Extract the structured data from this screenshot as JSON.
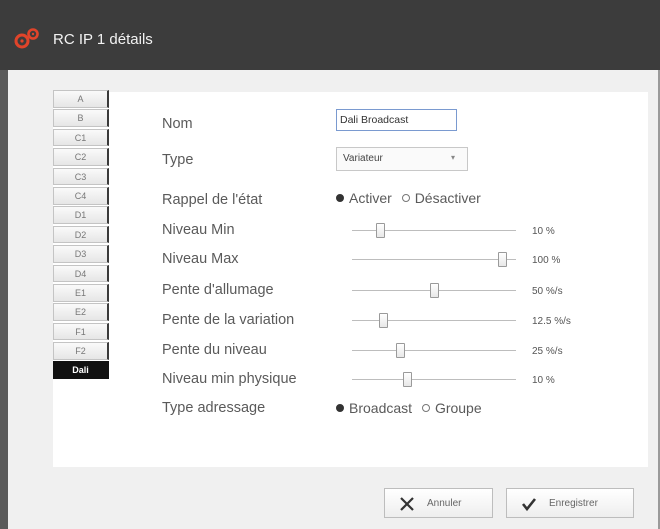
{
  "window": {
    "title": "RC IP 1 détails",
    "icon": "gears-icon"
  },
  "tabs": [
    "A",
    "B",
    "C1",
    "C2",
    "C3",
    "C4",
    "D1",
    "D2",
    "D3",
    "D4",
    "E1",
    "E2",
    "F1",
    "F2",
    "Dali"
  ],
  "active_tab": "Dali",
  "form": {
    "nom": {
      "label": "Nom",
      "value": "Dali Broadcast"
    },
    "type": {
      "label": "Type",
      "value": "Variateur"
    },
    "rappel": {
      "label": "Rappel de l'état",
      "options": [
        "Activer",
        "Désactiver"
      ],
      "selected": "Activer"
    },
    "niveau_min": {
      "label": "Niveau Min",
      "value_text": "10 %",
      "fraction": 0.1
    },
    "niveau_max": {
      "label": "Niveau Max",
      "value_text": "100 %",
      "fraction": 1.0
    },
    "pente_allumage": {
      "label": "Pente d'allumage",
      "value_text": "50 %/s",
      "fraction": 0.5
    },
    "pente_variation": {
      "label": "Pente de la variation",
      "value_text": "12.5 %/s",
      "fraction": 0.125
    },
    "pente_niveau": {
      "label": "Pente du niveau",
      "value_text": "25 %/s",
      "fraction": 0.25
    },
    "niveau_min_physique": {
      "label": "Niveau min physique",
      "value_text": "10 %",
      "fraction": 0.3
    },
    "type_adressage": {
      "label": "Type adressage",
      "options": [
        "Broadcast",
        "Groupe"
      ],
      "selected": "Broadcast"
    }
  },
  "buttons": {
    "annuler": "Annuler",
    "enregistrer": "Enregistrer"
  },
  "colors": {
    "titlebar": "#3c3c3c",
    "icon": "#e0442a",
    "active_tab": "#111111"
  }
}
